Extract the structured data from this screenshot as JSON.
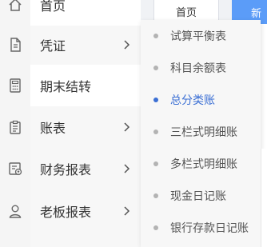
{
  "colors": {
    "accent": "#3b6fd4",
    "tab_active": "#5b9cf8",
    "menu_bg": "#f7f7f7"
  },
  "menu": [
    {
      "label": "首页",
      "icon": "home-icon",
      "has_arrow": false
    },
    {
      "label": "凭证",
      "icon": "document-icon",
      "has_arrow": true
    },
    {
      "label": "期末结转",
      "icon": "calculator-icon",
      "has_arrow": false
    },
    {
      "label": "账表",
      "icon": "clipboard-icon",
      "has_arrow": true
    },
    {
      "label": "财务报表",
      "icon": "financial-report-icon",
      "has_arrow": true
    },
    {
      "label": "老板报表",
      "icon": "user-icon",
      "has_arrow": true
    }
  ],
  "tabs": [
    {
      "label": "首页"
    },
    {
      "label": "新"
    }
  ],
  "submenu": [
    {
      "label": "试算平衡表",
      "selected": false
    },
    {
      "label": "科目余额表",
      "selected": false
    },
    {
      "label": "总分类账",
      "selected": true
    },
    {
      "label": "三栏式明细账",
      "selected": false
    },
    {
      "label": "多栏式明细账",
      "selected": false
    },
    {
      "label": "现金日记账",
      "selected": false
    },
    {
      "label": "银行存款日记账",
      "selected": false
    }
  ]
}
